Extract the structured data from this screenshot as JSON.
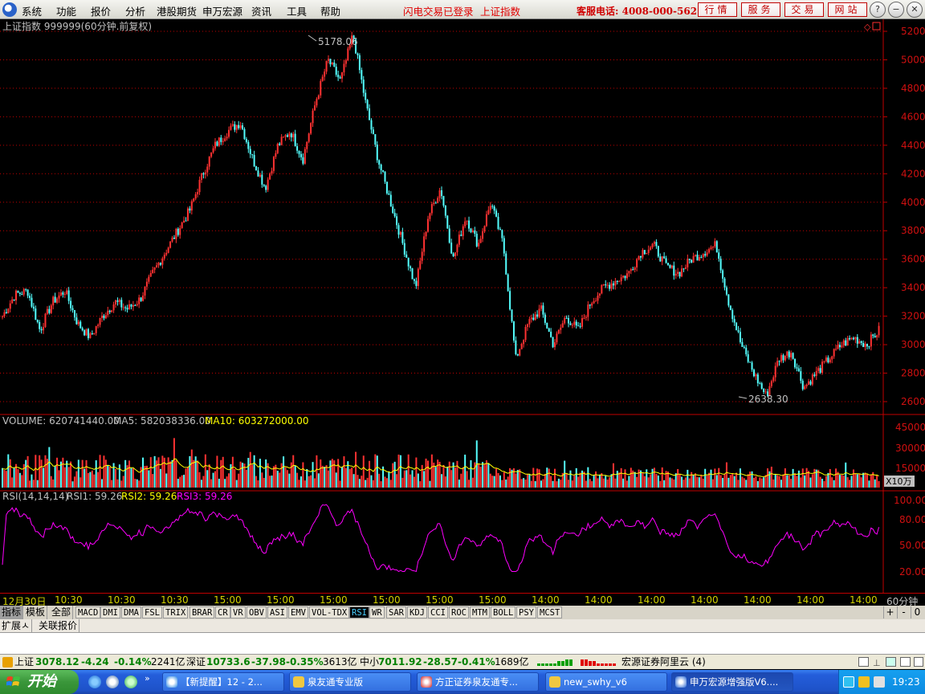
{
  "menubar": {
    "items": [
      "系统",
      "功能",
      "报价",
      "分析",
      "港股期货",
      "申万宏源",
      "资讯",
      "工具",
      "帮助"
    ],
    "status": [
      "闪电交易已登录",
      "上证指数"
    ],
    "hotline": "客服电话: 4008-000-562",
    "buttons": [
      "行情",
      "服务",
      "交易",
      "网站"
    ]
  },
  "chart": {
    "title": "上证指数 999999(60分钟.前复权)",
    "high_label": "5178.06",
    "low_label": "2638.30",
    "price_ticks": [
      "5200",
      "5000",
      "4800",
      "4600",
      "4400",
      "4200",
      "4000",
      "3800",
      "3600",
      "3400",
      "3200",
      "3000",
      "2800",
      "2600"
    ],
    "volume": {
      "label": "VOLUME: 620741440.00",
      "ma5": "MA5: 582038336.00",
      "ma10": "MA10: 603272000.00",
      "ticks": [
        "45000",
        "30000",
        "15000"
      ],
      "unit": "X10万"
    },
    "rsi": {
      "label": "RSI(14,14,14)",
      "rsi1": "RSI1: 59.26",
      "rsi2": "RSI2: 59.26",
      "rsi3": "RSI3: 59.26",
      "ticks": [
        "100.00",
        "80.00",
        "50.00",
        "20.00"
      ]
    },
    "x_labels": [
      "12月30日",
      "10:30",
      "10:30",
      "10:30",
      "15:00",
      "15:00",
      "15:00",
      "15:00",
      "15:00",
      "15:00",
      "15:00",
      "14:00",
      "14:00",
      "14:00",
      "14:00",
      "14:00",
      "14:00",
      "14:00"
    ],
    "x_unit": "60分钟",
    "colors": {
      "up": "#ff3232",
      "down": "#54ffff",
      "rsi": "#ff00ff",
      "ma": "#ffff00",
      "grid": "#c00000"
    }
  },
  "chart_data": {
    "type": "candlestick",
    "series": [
      {
        "name": "上证指数",
        "values": [
          3200,
          3350,
          3380,
          3100,
          3300,
          3380,
          3150,
          3050,
          3200,
          3300,
          3250,
          3320,
          3500,
          3650,
          3800,
          3950,
          4200,
          4400,
          4500,
          4560,
          4300,
          4100,
          4400,
          4500,
          4300,
          4700,
          5000,
          4850,
          5178.06,
          4700,
          4300,
          4000,
          3700,
          3400,
          3900,
          4100,
          3600,
          3900,
          3700,
          4000,
          3700,
          2900,
          3150,
          3250,
          3000,
          3200,
          3100,
          3300,
          3400,
          3450,
          3500,
          3650,
          3700,
          3550,
          3500,
          3600,
          3650,
          3700,
          3300,
          3000,
          2800,
          2638.3,
          2900,
          2950,
          2700,
          2800,
          2900,
          3000,
          3050,
          3000,
          3100
        ]
      }
    ]
  },
  "sidebar_tabs": [
    "指标",
    "模板",
    "全部"
  ],
  "indicator_tabs": [
    "MACD",
    "DMI",
    "DMA",
    "FSL",
    "TRIX",
    "BRAR",
    "CR",
    "VR",
    "OBV",
    "ASI",
    "EMV",
    "VOL-TDX",
    "RSI",
    "WR",
    "SAR",
    "KDJ",
    "CCI",
    "ROC",
    "MTM",
    "BOLL",
    "PSY",
    "MCST"
  ],
  "active_indicator": "RSI",
  "zoom": [
    "+",
    "-",
    "0"
  ],
  "bottom_tabs": [
    "扩展ㅅ",
    "关联报价"
  ],
  "status": {
    "sh_label": "上证",
    "sh_value": "3078.12",
    "sh_change": "-4.24",
    "sh_pct": "-0.14%",
    "sh_vol": "2241亿",
    "sz_label": "深证",
    "sz_value": "10733.6",
    "sz_change": "-37.98",
    "sz_pct": "-0.35%",
    "sz_vol": "3613亿",
    "zx_label": "中小",
    "zx_value": "7011.92",
    "zx_change": "-28.57",
    "zx_pct": "-0.41%",
    "zx_vol": "1689亿",
    "broker": "宏源证券阿里云 (4)"
  },
  "taskbar": {
    "start": "开始",
    "tasks": [
      "【新提醒】12 - 2...",
      "泉友通专业版",
      "方正证券泉友通专...",
      "new_swhy_v6",
      "申万宏源增强版V6...."
    ],
    "clock": "19:23"
  }
}
